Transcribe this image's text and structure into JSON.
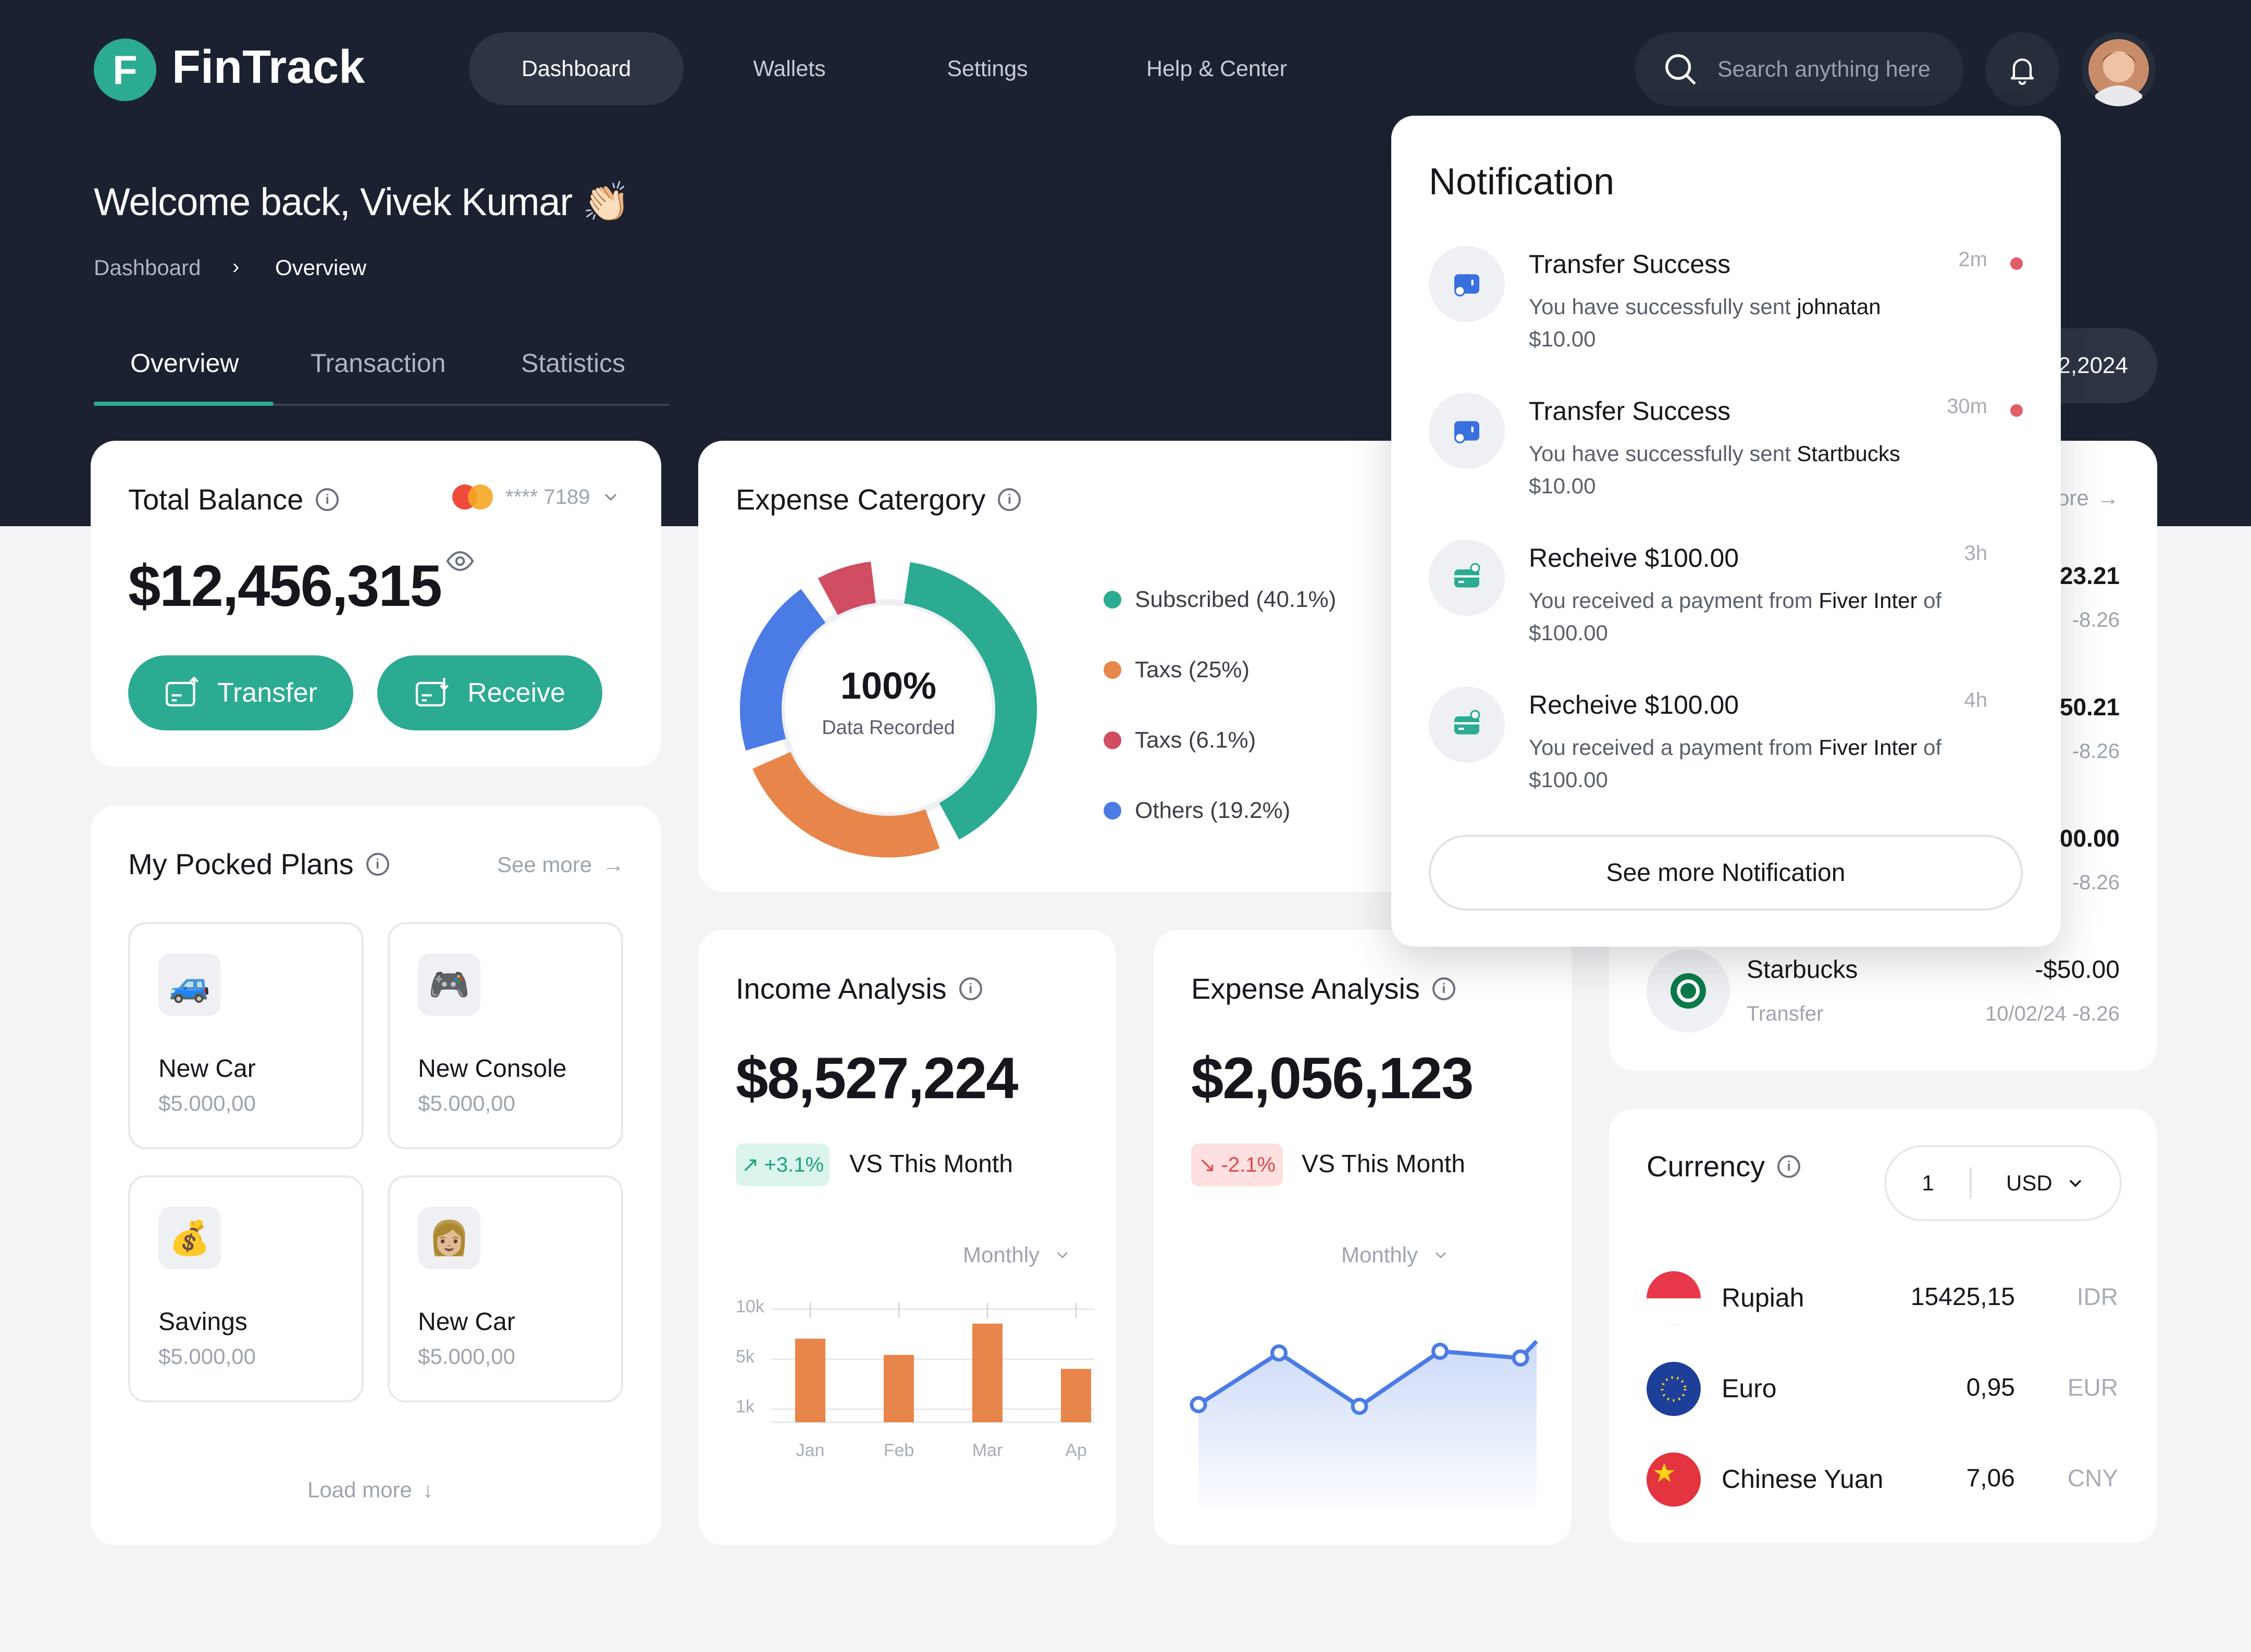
{
  "app": {
    "logo_letter": "F",
    "name": "FinTrack"
  },
  "nav": {
    "items": [
      "Dashboard",
      "Wallets",
      "Settings",
      "Help & Center"
    ],
    "active": "Dashboard"
  },
  "search": {
    "placeholder": "Search anything here"
  },
  "welcome": "Welcome back, Vivek Kumar 👏🏻",
  "breadcrumb": [
    "Dashboard",
    "Overview"
  ],
  "tabs": [
    "Overview",
    "Transaction",
    "Statistics"
  ],
  "date_partial": "2,2024",
  "total_balance": {
    "title": "Total Balance",
    "card_mask": "**** 7189",
    "amount": "$12,456,315",
    "transfer_label": "Transfer",
    "receive_label": "Receive"
  },
  "plans": {
    "title": "My Pocked Plans",
    "see_more": "See more",
    "load_more": "Load more",
    "items": [
      {
        "icon": "car-icon",
        "glyph": "🚙",
        "name": "New Car",
        "value": "$5.000,00"
      },
      {
        "icon": "gamepad-icon",
        "glyph": "🎮",
        "name": "New Console",
        "value": "$5.000,00"
      },
      {
        "icon": "money-bag-icon",
        "glyph": "💰",
        "name": "Savings",
        "value": "$5.000,00"
      },
      {
        "icon": "person-icon",
        "glyph": "👩🏼",
        "name": "New Car",
        "value": "$5.000,00"
      }
    ]
  },
  "expense_category": {
    "title": "Expense Catergory",
    "center_value": "100%",
    "center_label": "Data Recorded",
    "legend": [
      {
        "label": "Subscribed (40.1%)",
        "color": "#2bab92"
      },
      {
        "label": "Taxs (25%)",
        "color": "#e8854a"
      },
      {
        "label": "Taxs (6.1%)",
        "color": "#d04d62"
      },
      {
        "label": "Others (19.2%)",
        "color": "#4b7be5"
      }
    ]
  },
  "income": {
    "title": "Income Analysis",
    "amount": "$8,527,224",
    "change": "+3.1%",
    "vs": "VS This Month",
    "period": "Monthly",
    "yticks": [
      "10k",
      "5k",
      "1k"
    ],
    "chart_data": {
      "type": "bar",
      "categories": [
        "Jan",
        "Feb",
        "Mar",
        "Ap"
      ],
      "values": [
        7.2,
        5.8,
        8.5,
        4.6
      ],
      "ylim": [
        0,
        11
      ]
    }
  },
  "expense": {
    "title": "Expense Analysis",
    "amount": "$2,056,123",
    "change": "-2.1%",
    "vs": "VS This Month",
    "period": "Monthly",
    "chart_data": {
      "type": "line",
      "x": [
        0,
        1,
        2,
        3,
        4,
        4.2
      ],
      "values": [
        3.4,
        6.5,
        3.3,
        6.6,
        6.2,
        7.2
      ],
      "ylim": [
        0,
        10
      ]
    }
  },
  "transactions": {
    "see_more_partial": "ore",
    "rows": [
      {
        "amount": "23.21",
        "meta": "-8.26"
      },
      {
        "amount": "50.21",
        "meta": "-8.26"
      },
      {
        "amount": "00.00",
        "meta": "-8.26"
      },
      {
        "name": "Starbucks",
        "type": "Transfer",
        "amount": "-$50.00",
        "meta": "10/02/24 -8.26"
      }
    ]
  },
  "currency": {
    "title": "Currency",
    "qty": "1",
    "base": "USD",
    "rows": [
      {
        "name": "Rupiah",
        "rate": "15425,15",
        "code": "IDR",
        "flag": "flag-indonesia-icon"
      },
      {
        "name": "Euro",
        "rate": "0,95",
        "code": "EUR",
        "flag": "flag-eu-icon"
      },
      {
        "name": "Chinese Yuan",
        "rate": "7,06",
        "code": "CNY",
        "flag": "flag-china-icon"
      }
    ]
  },
  "notification": {
    "title": "Notification",
    "see_more": "See more Notification",
    "items": [
      {
        "title": "Transfer Success",
        "prefix": "You have successfully sent ",
        "who": "johnatan",
        "suffix": "",
        "amount": "$10.00",
        "time": "2m",
        "unread": true,
        "icon": "transfer-icon"
      },
      {
        "title": "Transfer Success",
        "prefix": "You have successfully sent ",
        "who": "Startbucks",
        "suffix": "",
        "amount": "$10.00",
        "time": "30m",
        "unread": true,
        "icon": "transfer-icon"
      },
      {
        "title": "Recheive $100.00",
        "prefix": "You received a payment from ",
        "who": "Fiver Inter",
        "suffix": " of",
        "amount": "$100.00",
        "time": "3h",
        "unread": false,
        "icon": "payment-card-icon"
      },
      {
        "title": "Recheive $100.00",
        "prefix": "You received a payment from ",
        "who": "Fiver Inter",
        "suffix": " of",
        "amount": "$100.00",
        "time": "4h",
        "unread": false,
        "icon": "payment-card-icon"
      }
    ]
  }
}
